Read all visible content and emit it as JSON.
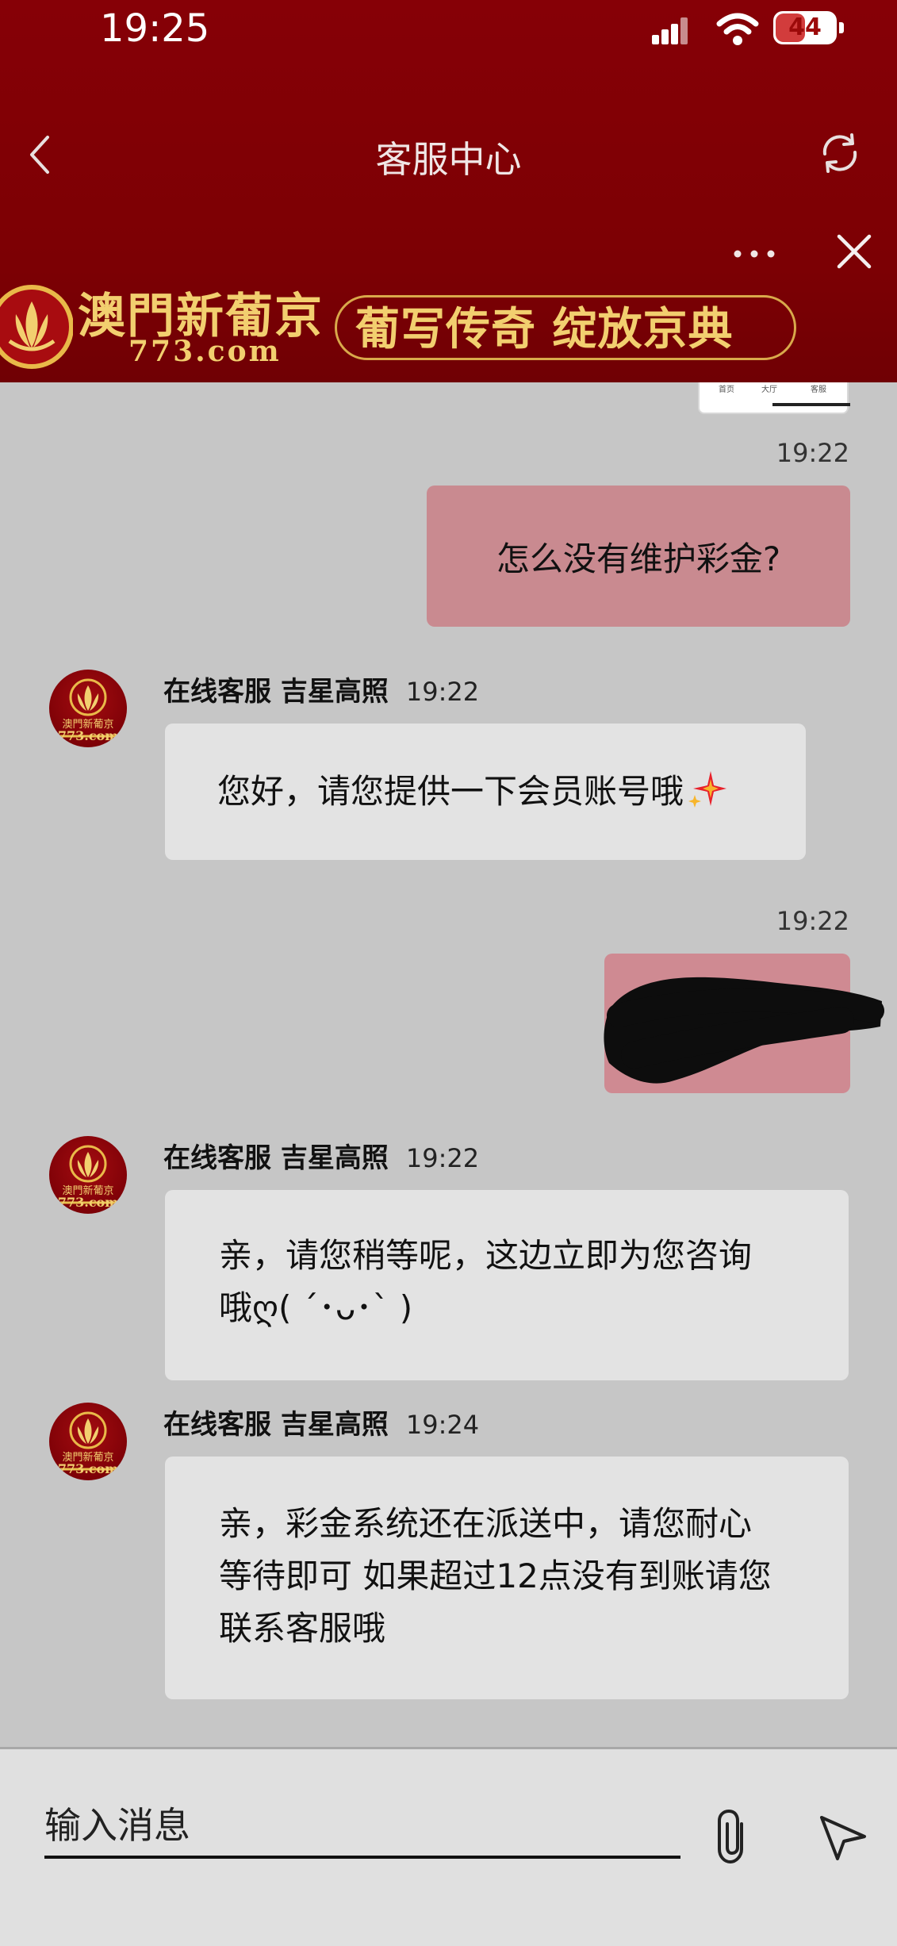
{
  "status_bar": {
    "time": "19:25",
    "battery": "44"
  },
  "nav": {
    "title": "客服中心",
    "back_icon": "chevron-left-icon",
    "refresh_icon": "refresh-icon",
    "more_icon": "more-horizontal-icon",
    "close_icon": "close-icon"
  },
  "banner": {
    "brand_name": "澳門新葡京",
    "brand_url": "773.com",
    "slogan": "葡写传奇 绽放京典",
    "emblem_icon": "lotus-logo-icon",
    "colors": {
      "background": "#7c0004",
      "gold": "#f2cf6f"
    }
  },
  "chat": {
    "prev_image_tabs": [
      "首页",
      "大厅",
      "客服"
    ],
    "messages": [
      {
        "direction": "out",
        "time": "19:22",
        "text": "怎么没有维护彩金?"
      },
      {
        "direction": "in",
        "sender": "在线客服 吉星高照",
        "time": "19:22",
        "text": "您好，请您提供一下会员账号哦",
        "emoji": "sparkles-icon"
      },
      {
        "direction": "out",
        "time": "19:22",
        "text": ""
      },
      {
        "direction": "in",
        "sender": "在线客服 吉星高照",
        "time": "19:22",
        "lines": [
          "亲，请您稍等呢，这边立即为您咨询",
          "哦ღ( ´･ᴗ･` )"
        ]
      },
      {
        "direction": "in",
        "sender": "在线客服 吉星高照",
        "time": "19:24",
        "lines": [
          "亲，彩金系统还在派送中，请您耐心",
          "等待即可 如果超过12点没有到账请您",
          "联系客服哦"
        ]
      }
    ],
    "avatar": {
      "name": "澳門新葡京",
      "url": "773.com"
    },
    "colors": {
      "outgoing": "#c98a90",
      "incoming": "#e3e3e3",
      "background": "#c6c6c6"
    }
  },
  "input": {
    "placeholder": "输入消息",
    "attach_icon": "paperclip-icon",
    "send_icon": "send-icon"
  }
}
